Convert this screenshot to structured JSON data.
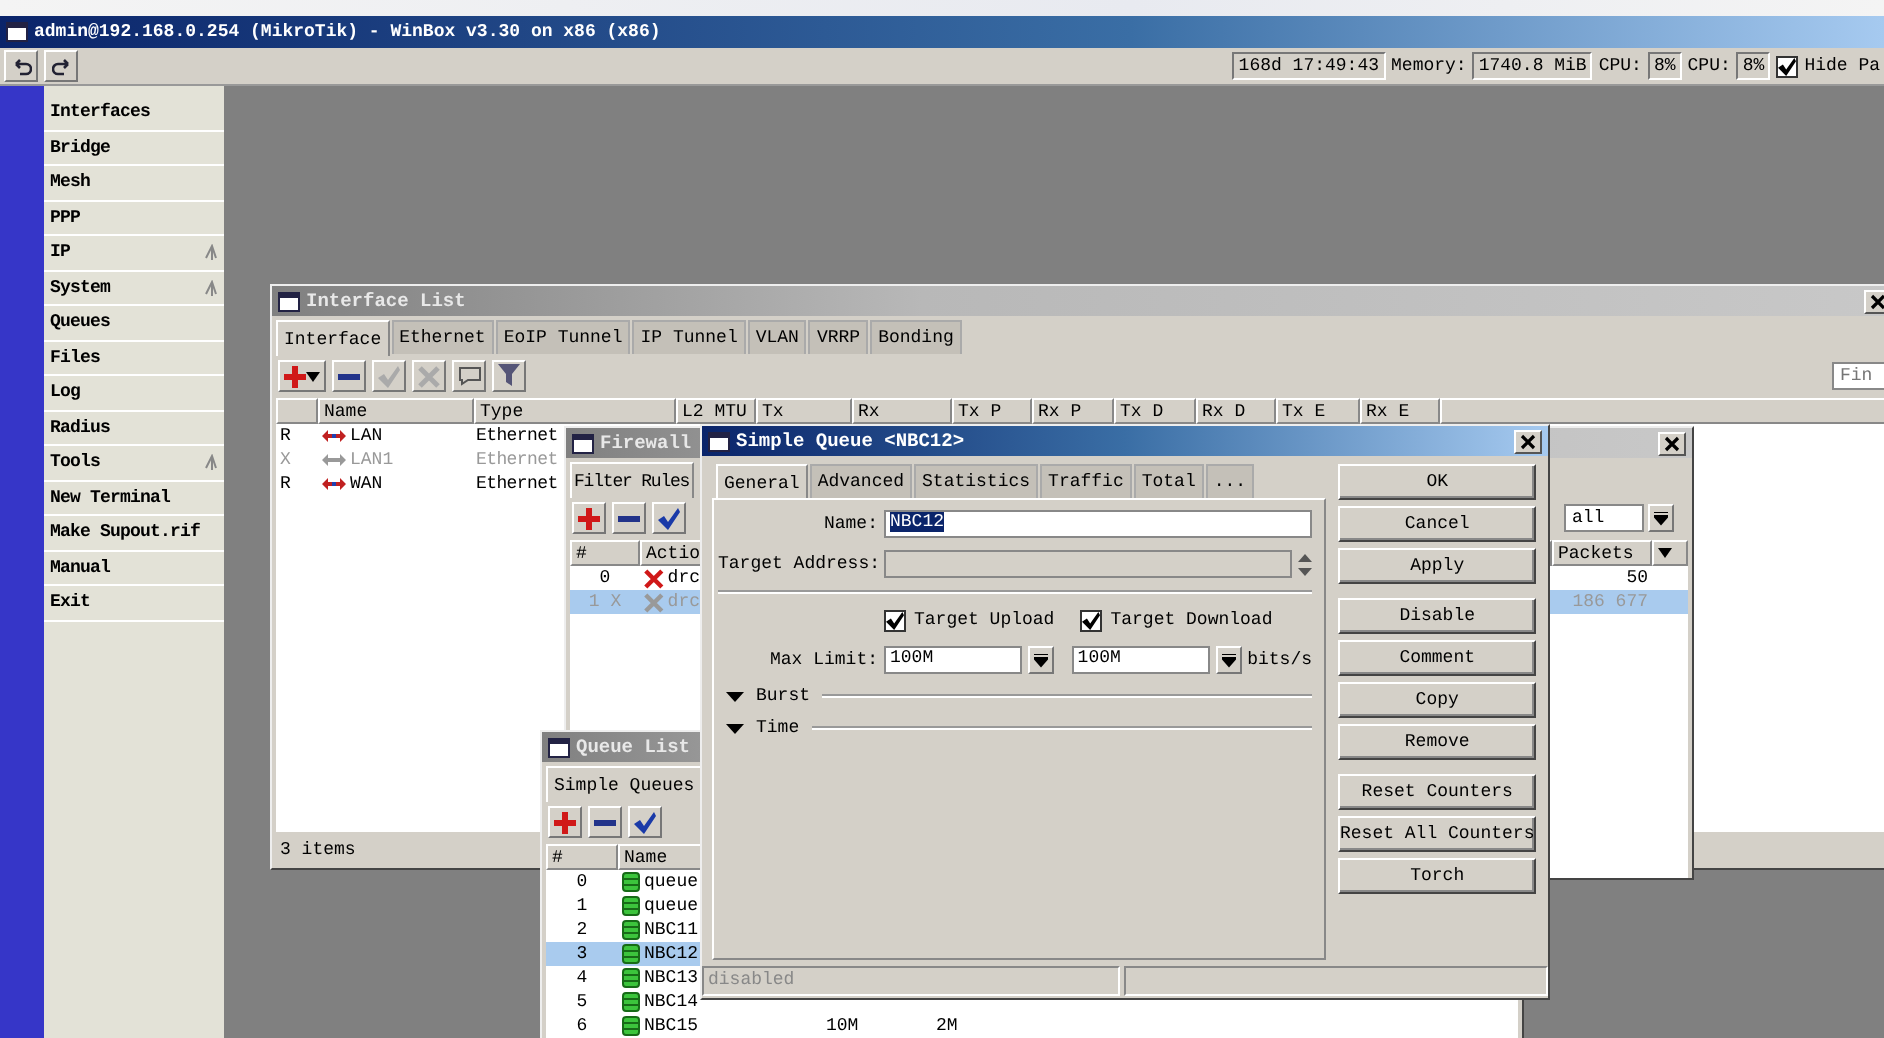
{
  "window": {
    "title": "admin@192.168.0.254 (MikroTik) - WinBox v3.30 on x86 (x86)"
  },
  "toolbar": {
    "uptime": "168d 17:49:43",
    "memory_label": "Memory:",
    "memory": "1740.8 MiB",
    "cpu_label": "CPU:",
    "cpu": "8%",
    "cpu2_label": "CPU:",
    "cpu2": "8%",
    "hide_passwords": {
      "label": "Hide Pa",
      "checked": true
    }
  },
  "menu": [
    {
      "label": "Interfaces",
      "submenu": false
    },
    {
      "label": "Bridge",
      "submenu": false
    },
    {
      "label": "Mesh",
      "submenu": false
    },
    {
      "label": "PPP",
      "submenu": false
    },
    {
      "label": "IP",
      "submenu": true
    },
    {
      "label": "System",
      "submenu": true
    },
    {
      "label": "Queues",
      "submenu": false
    },
    {
      "label": "Files",
      "submenu": false
    },
    {
      "label": "Log",
      "submenu": false
    },
    {
      "label": "Radius",
      "submenu": false
    },
    {
      "label": "Tools",
      "submenu": true
    },
    {
      "label": "New Terminal",
      "submenu": false
    },
    {
      "label": "Make Supout.rif",
      "submenu": false
    },
    {
      "label": "Manual",
      "submenu": false
    },
    {
      "label": "Exit",
      "submenu": false
    }
  ],
  "interface_list": {
    "title": "Interface List",
    "tabs": [
      {
        "label": "Interface",
        "selected": true
      },
      {
        "label": "Ethernet",
        "selected": false
      },
      {
        "label": "EoIP Tunnel",
        "selected": false
      },
      {
        "label": "IP Tunnel",
        "selected": false
      },
      {
        "label": "VLAN",
        "selected": false
      },
      {
        "label": "VRRP",
        "selected": false
      },
      {
        "label": "Bonding",
        "selected": false
      }
    ],
    "find_placeholder": "Fin",
    "columns": [
      "Name",
      "Type",
      "L2 MTU",
      "Tx",
      "Rx",
      "Tx P",
      "Rx P",
      "Tx D",
      "Rx D",
      "Tx E",
      "Rx E"
    ],
    "rows": [
      {
        "flag": "R",
        "name": "LAN",
        "type": "Ethernet",
        "disabled": false
      },
      {
        "flag": "X",
        "name": "LAN1",
        "type": "Ethernet",
        "disabled": true
      },
      {
        "flag": "R",
        "name": "WAN",
        "type": "Ethernet",
        "disabled": false
      }
    ],
    "status": "3 items"
  },
  "firewall": {
    "title": "Firewall",
    "tabs": [
      {
        "label": "Filter Rules",
        "selected": true
      }
    ],
    "filter_value": "all",
    "columns": [
      "#",
      "Actio",
      "Packets"
    ],
    "rows": [
      {
        "number": "0",
        "action": "drc",
        "packets": "50",
        "disabled": false,
        "selected": false
      },
      {
        "number": "1 X",
        "action": "drc",
        "packets": "186 677",
        "disabled": true,
        "selected": true
      }
    ]
  },
  "queue_list": {
    "title": "Queue List",
    "tabs": [
      {
        "label": "Simple Queues",
        "selected": true
      }
    ],
    "columns": [
      "#",
      "Name"
    ],
    "rows": [
      {
        "number": "0",
        "name": "queue",
        "selected": false
      },
      {
        "number": "1",
        "name": "queue",
        "selected": false
      },
      {
        "number": "2",
        "name": "NBC11",
        "selected": false
      },
      {
        "number": "3",
        "name": "NBC12",
        "selected": true
      },
      {
        "number": "4",
        "name": "NBC13",
        "selected": false
      },
      {
        "number": "5",
        "name": "NBC14",
        "selected": false
      },
      {
        "number": "6",
        "name": "NBC15",
        "selected": false,
        "column_4": "10M",
        "column_5": "2M"
      }
    ]
  },
  "simple_queue": {
    "title": "Simple Queue <NBC12>",
    "tabs": [
      {
        "label": "General",
        "selected": true
      },
      {
        "label": "Advanced",
        "selected": false
      },
      {
        "label": "Statistics",
        "selected": false
      },
      {
        "label": "Traffic",
        "selected": false
      },
      {
        "label": "Total",
        "selected": false
      },
      {
        "label": "...",
        "selected": false
      }
    ],
    "name_label": "Name:",
    "name": "NBC12",
    "name_selected": true,
    "target_address_label": "Target Address:",
    "target_upload": {
      "label": "Target Upload",
      "checked": true
    },
    "target_download": {
      "label": "Target Download",
      "checked": true
    },
    "max_limit_label": "Max Limit:",
    "max_limit_upload": "100M",
    "max_limit_download": "100M",
    "unit": "bits/s",
    "sections": [
      "Burst",
      "Time"
    ],
    "button_groups": [
      [
        "OK",
        "Cancel",
        "Apply"
      ],
      [
        "Disable",
        "Comment",
        "Copy",
        "Remove"
      ],
      [
        "Reset Counters",
        "Reset All Counters",
        "Torch"
      ]
    ],
    "status": "disabled"
  }
}
